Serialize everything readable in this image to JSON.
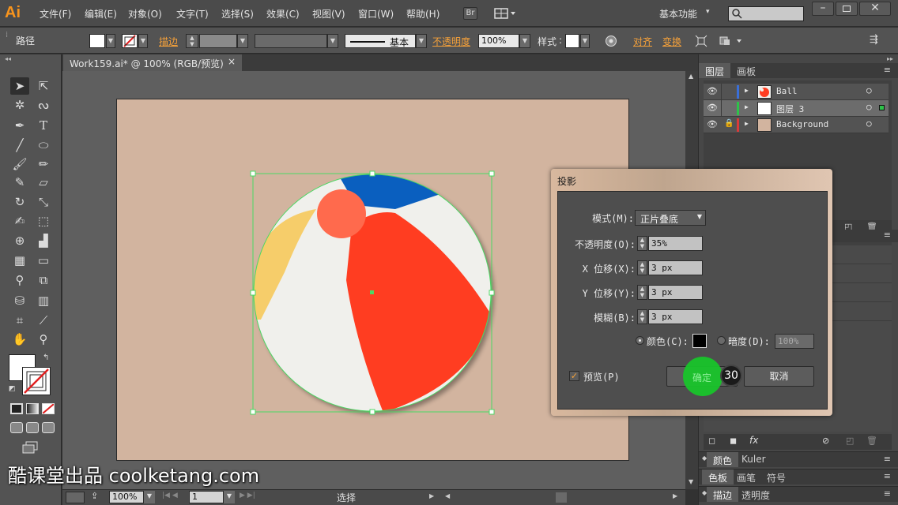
{
  "app": {
    "logo": "Ai"
  },
  "menu": [
    "文件(F)",
    "编辑(E)",
    "对象(O)",
    "文字(T)",
    "选择(S)",
    "效果(C)",
    "视图(V)",
    "窗口(W)",
    "帮助(H)"
  ],
  "menu_right": {
    "bridge": "Br",
    "workspace": "基本功能"
  },
  "control": {
    "object_type": "路径",
    "stroke_label": "描边",
    "stroke_style": "基本",
    "opacity_label": "不透明度",
    "opacity_value": "100%",
    "style_label": "样式",
    "align_label": "对齐",
    "transform_label": "变换"
  },
  "document": {
    "tab_title": "Work159.ai* @ 100% (RGB/预览)",
    "close": "×"
  },
  "status": {
    "zoom": "100%",
    "page": "1",
    "tool": "选择"
  },
  "layers_panel": {
    "tabs": [
      "图层",
      "画板"
    ],
    "rows": [
      {
        "name": "Ball",
        "color": "#3a6fd8",
        "selected": false,
        "locked": false
      },
      {
        "name": "图层 3",
        "color": "#2ec24a",
        "selected": true,
        "locked": false
      },
      {
        "name": "Background",
        "color": "#d83a3a",
        "selected": false,
        "locked": true
      }
    ]
  },
  "right_panels": {
    "color_tabs": [
      "颜色",
      "Kuler"
    ],
    "swatch_tabs": [
      "色板",
      "画笔",
      "符号"
    ],
    "stroke_tabs": [
      "描边",
      "透明度"
    ]
  },
  "dialog": {
    "title": "投影",
    "mode_label": "模式(M):",
    "mode_value": "正片叠底",
    "opacity_label": "不透明度(O):",
    "opacity_value": "35%",
    "x_label": "X 位移(X):",
    "x_value": "3 px",
    "y_label": "Y 位移(Y):",
    "y_value": "3 px",
    "blur_label": "模糊(B):",
    "blur_value": "3 px",
    "color_label": "颜色(C):",
    "darkness_label": "暗度(D):",
    "darkness_value": "100%",
    "preview_label": "预览(P)",
    "ok_label": "确定",
    "cancel_label": "取消",
    "step_badge": "30"
  },
  "watermark": "酷课堂出品 coolketang.com",
  "colors": {
    "artboard": "#d2b49f",
    "accent": "#f7941d",
    "selection": "#4cd864",
    "ball_red": "#ff3d21",
    "ball_blue": "#0a5fbf",
    "ball_yellow": "#f6cd6a",
    "ball_white": "#f0f0ec",
    "ball_cap": "#ff6a4d"
  }
}
